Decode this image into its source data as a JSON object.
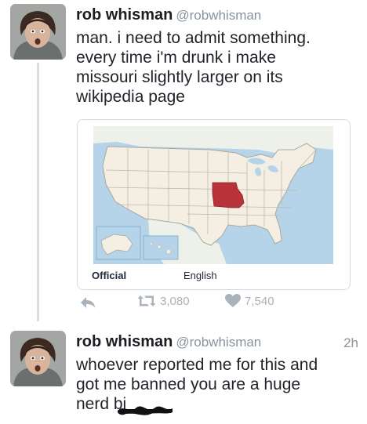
{
  "tweets": [
    {
      "display_name": "rob whisman",
      "handle": "@robwhisman",
      "text": "man. i need to admit something.\nevery time i'm drunk i make\nmissouri slightly larger on its\nwikipedia page",
      "media": {
        "map_subject": "United States map with Missouri highlighted",
        "highlight_color": "#b8323a",
        "land_color": "#f4efe2",
        "water_color": "#b5d4ea",
        "border_color": "#a8a8a0",
        "left_label": "Official",
        "right_label": "English"
      },
      "actions": {
        "reply_icon": "reply-icon",
        "retweet_icon": "retweet-icon",
        "retweet_count": "3,080",
        "like_icon": "heart-icon",
        "like_count": "7,540"
      }
    },
    {
      "display_name": "rob whisman",
      "handle": "@robwhisman",
      "timestamp": "2h",
      "text": "whoever reported me for this and\ngot me banned you are a huge\nnerd bi"
    }
  ]
}
